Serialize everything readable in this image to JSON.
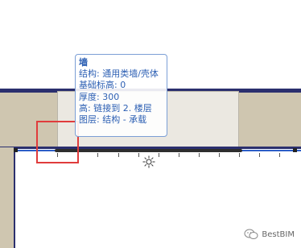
{
  "tooltip": {
    "title": "墙",
    "lines": [
      "结构: 通用类墙/壳体",
      "基础标高: 0",
      "厚度: 300",
      "高: 链接到 2. 楼层",
      "图层: 结构 - 承载"
    ]
  },
  "watermark": {
    "text": "BestBIM",
    "icon": "wechat-icon"
  },
  "colors": {
    "wall_fill": "#cfc6b0",
    "wall_edge": "#2b2f6e",
    "floor_line": "#2d5fc8",
    "tooltip_text": "#2c5fb3",
    "annotation_box": "#e03c3c"
  }
}
